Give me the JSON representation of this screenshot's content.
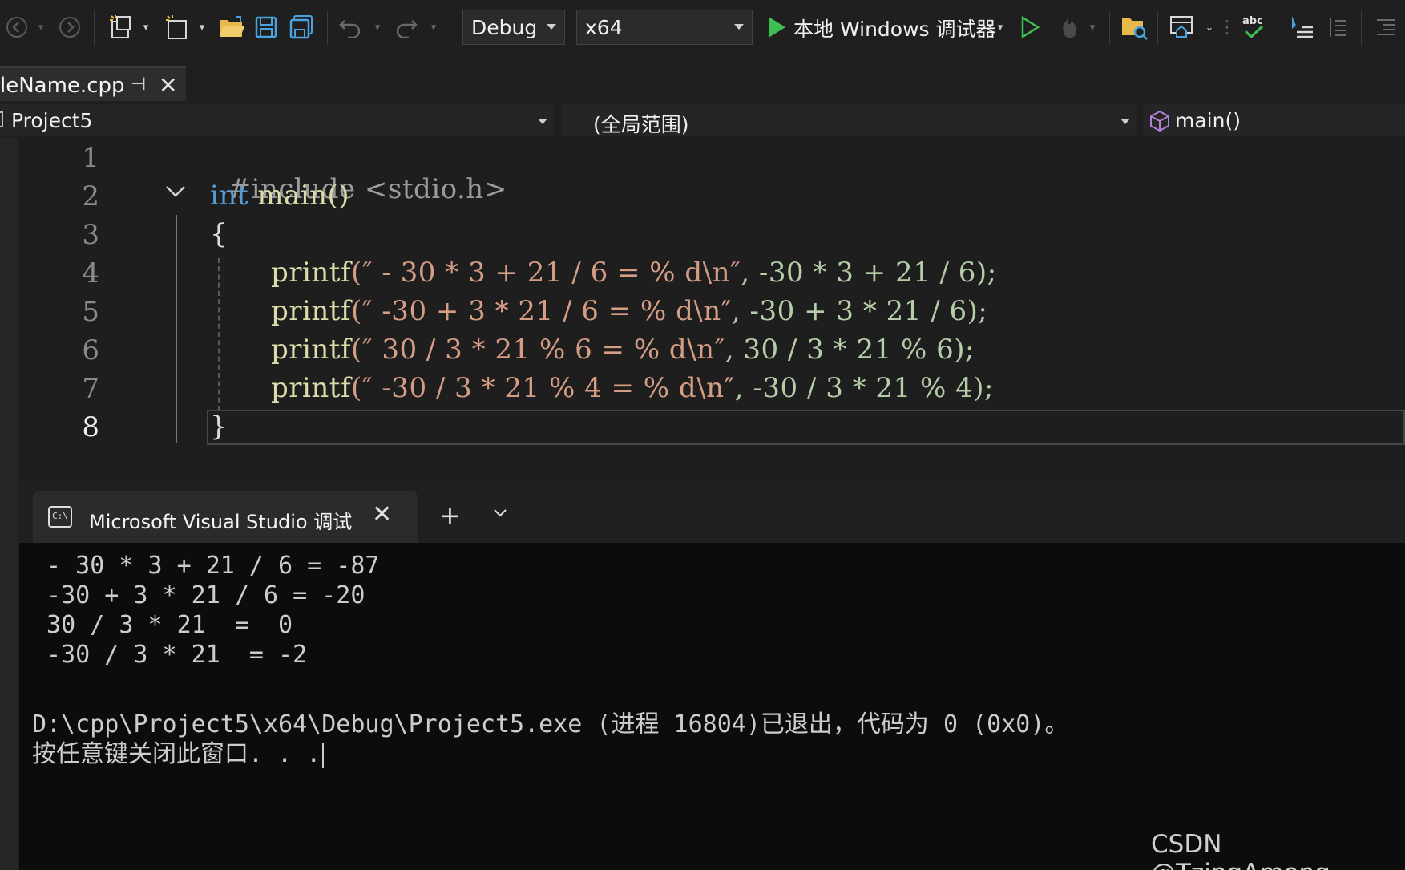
{
  "toolbar": {
    "config": "Debug",
    "platform": "x64",
    "debugger_label": "本地 Windows 调试器",
    "icons": [
      "back-icon",
      "forward-icon",
      "new-project-icon",
      "add-item-icon",
      "open-folder-icon",
      "save-icon",
      "save-all-icon",
      "undo-icon",
      "redo-icon",
      "start-debug-icon",
      "start-without-debug-icon",
      "hot-reload-icon",
      "solution-explorer-icon",
      "server-explorer-icon",
      "spellcheck-icon",
      "comment-icon",
      "format-icon",
      "indent-icon"
    ]
  },
  "tab": {
    "filename": "leName.cpp"
  },
  "navbar": {
    "project": "Project5",
    "scope": "(全局范围)",
    "member": "main()"
  },
  "editor": {
    "line_numbers": [
      "1",
      "2",
      "3",
      "4",
      "5",
      "6",
      "7",
      "8"
    ],
    "active_line": "8",
    "lines": {
      "l1_pp": "#include <stdio.h>",
      "l2_kw": "int",
      "l2_rest": " main()",
      "l3": "{",
      "l4_fn": "printf",
      "l4_str": "(″ - 30 * 3 + 21 / 6 = % d\\n″",
      "l4_rest": ", -30 * 3 + 21 / 6);",
      "l5_fn": "printf",
      "l5_str": "(″ -30 + 3 * 21 / 6 = % d\\n″",
      "l5_rest": ", -30 + 3 * 21 / 6);",
      "l6_fn": "printf",
      "l6_str": "(″ 30 / 3 * 21 % 6 = % d\\n″",
      "l6_rest": ", 30 / 3 * 21 % 6);",
      "l7_fn": "printf",
      "l7_str": "(″ -30 / 3 * 21 % 4 = % d\\n″",
      "l7_rest": ", -30 / 3 * 21 % 4);",
      "l8": "}"
    }
  },
  "terminal": {
    "tab_title": "Microsoft Visual Studio 调试控制台",
    "output": [
      " - 30 * 3 + 21 / 6 = -87",
      " -30 + 3 * 21 / 6 = -20",
      " 30 / 3 * 21  =  0",
      " -30 / 3 * 21  = -2"
    ],
    "exit_message": "D:\\cpp\\Project5\\x64\\Debug\\Project5.exe (进程 16804)已退出，代码为 0 (0x0)。",
    "prompt": "按任意键关闭此窗口. . ."
  },
  "watermark": "CSDN @TzingAmong"
}
